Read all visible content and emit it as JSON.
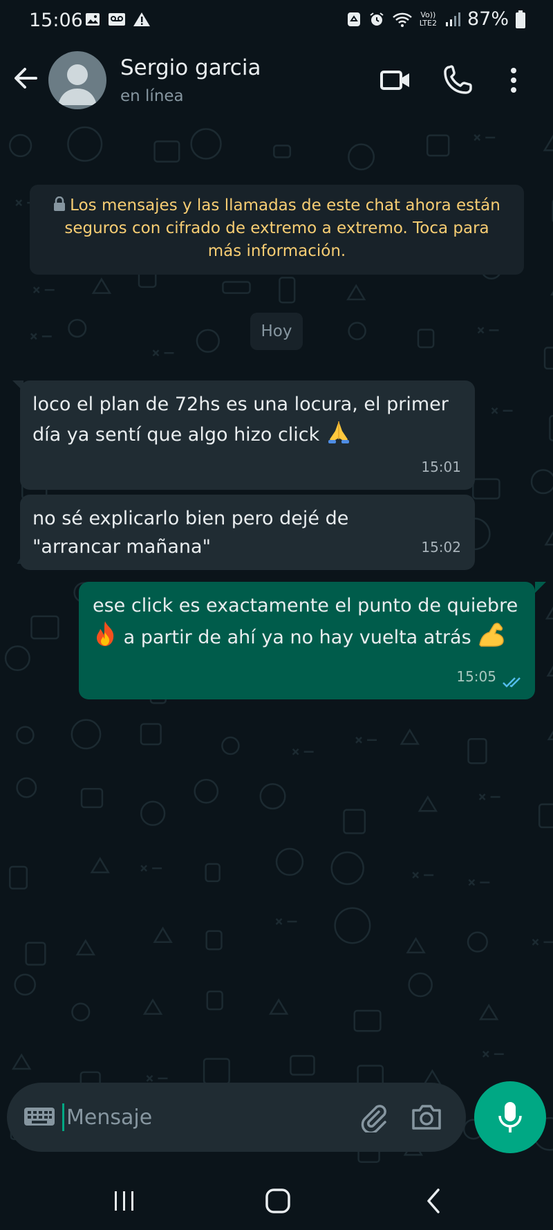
{
  "status_bar": {
    "time": "15:06",
    "battery": "87%",
    "network_top": "Vo))",
    "network_bottom": "LTE2",
    "left_icons": [
      "image-icon",
      "voicemail-icon",
      "warning-icon"
    ],
    "right_icons": [
      "recycle-icon",
      "alarm-icon",
      "wifi-icon",
      "signal-icon",
      "battery-icon"
    ]
  },
  "header": {
    "contact_name": "Sergio garcia",
    "contact_status": "en línea",
    "actions": [
      "video-call-icon",
      "voice-call-icon",
      "more-options-icon"
    ]
  },
  "encryption_notice": "Los mensajes y las llamadas de este chat ahora están seguros con cifrado de extremo a extremo. Toca para más información.",
  "date_separator": "Hoy",
  "messages": [
    {
      "direction": "incoming",
      "text": "loco el plan de 72hs es una locura, el primer día ya sentí que algo hizo click",
      "emoji": "folded-hands-emoji",
      "time": "15:01"
    },
    {
      "direction": "incoming",
      "text": "no sé explicarlo bien pero dejé de \"arrancar mañana\"",
      "time": "15:02"
    },
    {
      "direction": "outgoing",
      "text_part1": "ese click es exactamente el punto de quiebre",
      "emoji1": "fire-emoji",
      "text_part2": "a partir de ahí ya no hay vuelta atrás",
      "emoji2": "flexed-biceps-emoji",
      "time": "15:05",
      "status": "read"
    }
  ],
  "composer": {
    "placeholder": "Mensaje"
  },
  "colors": {
    "background": "#0b141a",
    "incoming_bubble": "#202c33",
    "outgoing_bubble": "#005c4b",
    "accent": "#00a884",
    "notice_text": "#f7cd73",
    "read_ticks": "#53bdeb"
  }
}
